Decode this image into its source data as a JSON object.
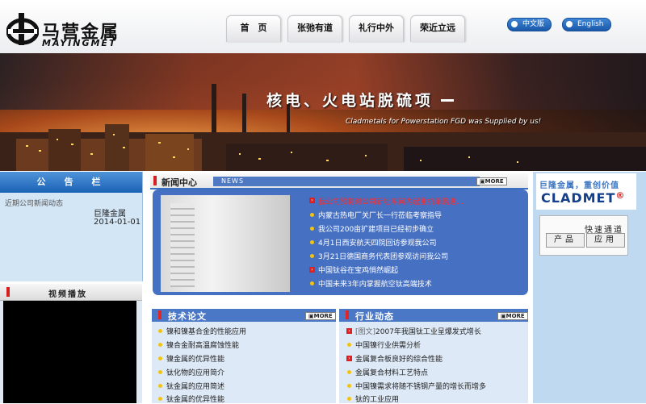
{
  "brand": {
    "name_cn": "马营金属",
    "name_en": "MAYINGMET"
  },
  "nav": {
    "items": [
      "首　页",
      "张弛有道",
      "礼行中外",
      "荣近立远"
    ]
  },
  "language": {
    "chinese": "中文版",
    "english": "English"
  },
  "banner": {
    "title": "核电、火电站脱硫项",
    "subtitle": "Cladmetals for Powerstation FGD was Supplied by us!"
  },
  "notice": {
    "title": "公　告　栏",
    "scroll_text": "近期公司新闻动态",
    "company": "巨隆金属",
    "date": "2014-01-01"
  },
  "video": {
    "title": "视频播放"
  },
  "news_center": {
    "title": "新闻中心",
    "tag": "NEWS",
    "more": "MORE",
    "items": [
      "我公司预将对公司新址车间内起重机采购进…",
      "内蒙古热电厂关厂长一行莅临考察指导",
      "我公司200亩扩建项目已经初步确立",
      "4月1日西安航天四院回访参观我公司",
      "3月21日德国商务代表团参观访问我公司",
      "中国钛谷在宝鸡悄然崛起",
      "中国未来3年内掌握航空钛高端技术"
    ]
  },
  "tech_papers": {
    "title": "技术论文",
    "more": "MORE",
    "items": [
      "镍和镍基合金的性能应用",
      "镍合金耐高温腐蚀性能",
      "镍金属的优异性能",
      "钛化物的应用简介",
      "钛金属的应用简述",
      "钛金属的优异性能"
    ]
  },
  "industry_news": {
    "title": "行业动态",
    "more": "MORE",
    "tag": "[图文]",
    "items": [
      "2007年我国钛工业呈爆发式增长",
      "中国镍行业供需分析",
      "金属复合板良好的综合性能",
      "金属复合材料工艺特点",
      "中国镍需求将随不锈钢产量的增长而增多",
      "钛的工业应用"
    ]
  },
  "sidebar": {
    "slogan": "巨隆金属，重创价值",
    "logo": "CLADMET",
    "registered": "®",
    "quick_title": "快速通道",
    "quick_buttons": [
      "产品",
      "应用"
    ]
  }
}
